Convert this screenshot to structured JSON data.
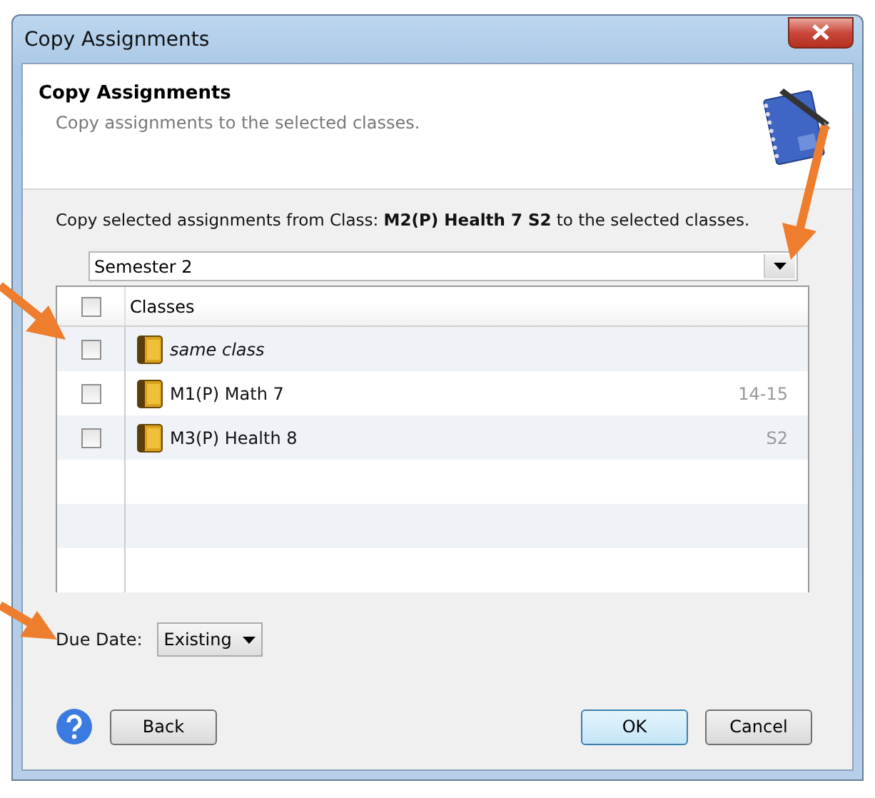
{
  "window": {
    "title": "Copy Assignments"
  },
  "header": {
    "title": "Copy Assignments",
    "subtitle": "Copy assignments to the selected classes."
  },
  "instruction": "Copy selected assignments from Class: **M2(P) Health 7 S2** to the selected classes.",
  "term_select": {
    "value": "Semester 2"
  },
  "table": {
    "select_all_checked": false,
    "columns": [
      "Classes"
    ],
    "rows": [
      {
        "kind": "same",
        "name": "same class",
        "term": "",
        "checked": false
      },
      {
        "kind": "class",
        "name": "M1(P) Math 7",
        "term": "14-15",
        "checked": false
      },
      {
        "kind": "class",
        "name": "M3(P) Health 8",
        "term": "S2",
        "checked": false
      }
    ]
  },
  "due_date": {
    "label": "Due Date:",
    "value": "Existing"
  },
  "buttons": {
    "back": "Back",
    "ok": "OK",
    "cancel": "Cancel"
  }
}
